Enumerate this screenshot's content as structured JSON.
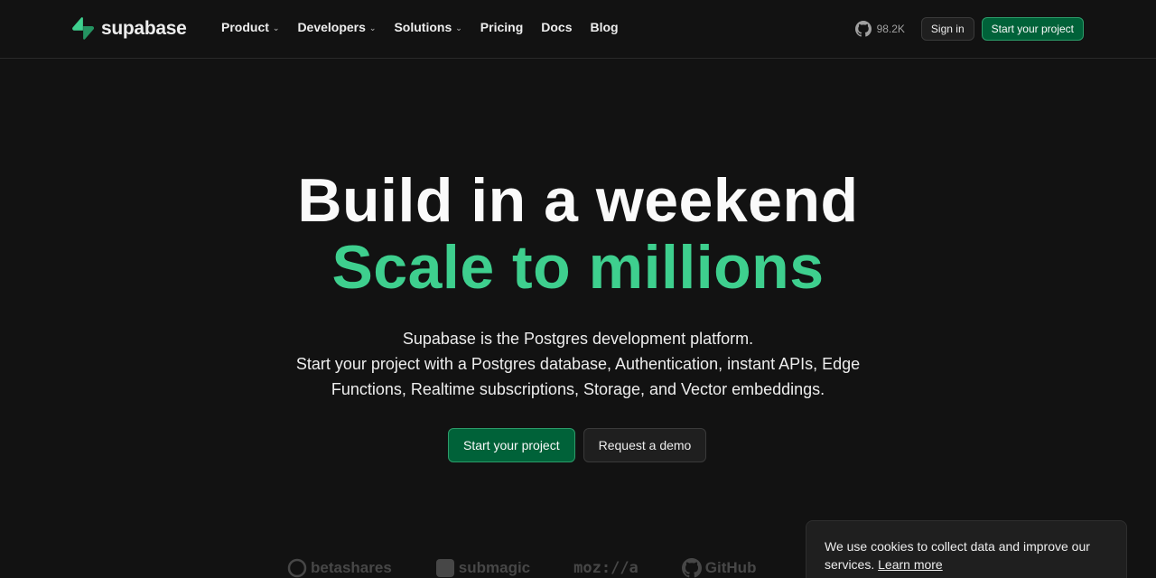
{
  "brand": {
    "name": "supabase",
    "accent": "#3ecf8e"
  },
  "nav": {
    "items": [
      {
        "label": "Product",
        "dropdown": true
      },
      {
        "label": "Developers",
        "dropdown": true
      },
      {
        "label": "Solutions",
        "dropdown": true
      },
      {
        "label": "Pricing",
        "dropdown": false
      },
      {
        "label": "Docs",
        "dropdown": false
      },
      {
        "label": "Blog",
        "dropdown": false
      }
    ],
    "github_stars": "98.2K",
    "sign_in": "Sign in",
    "start_project": "Start your project"
  },
  "hero": {
    "title_line1": "Build in a weekend",
    "title_line2": "Scale to millions",
    "subtitle_line1": "Supabase is the Postgres development platform.",
    "subtitle_line2": "Start your project with a Postgres database, Authentication, instant APIs, Edge",
    "subtitle_line3": "Functions, Realtime subscriptions, Storage, and Vector embeddings.",
    "primary_cta": "Start your project",
    "secondary_cta": "Request a demo"
  },
  "customer_logos": [
    {
      "name": "betashares",
      "icon": "betashares-icon"
    },
    {
      "name": "submagic",
      "icon": "submagic-icon"
    },
    {
      "name": "moz://a",
      "icon": ""
    },
    {
      "name": "GitHub",
      "icon": "github-icon"
    }
  ],
  "cookie_banner": {
    "text": "We use cookies to collect data and improve our services.",
    "link": "Learn more"
  },
  "colors": {
    "background": "#121212",
    "primary_button": "#006239",
    "primary_border": "#2c9c6a"
  }
}
